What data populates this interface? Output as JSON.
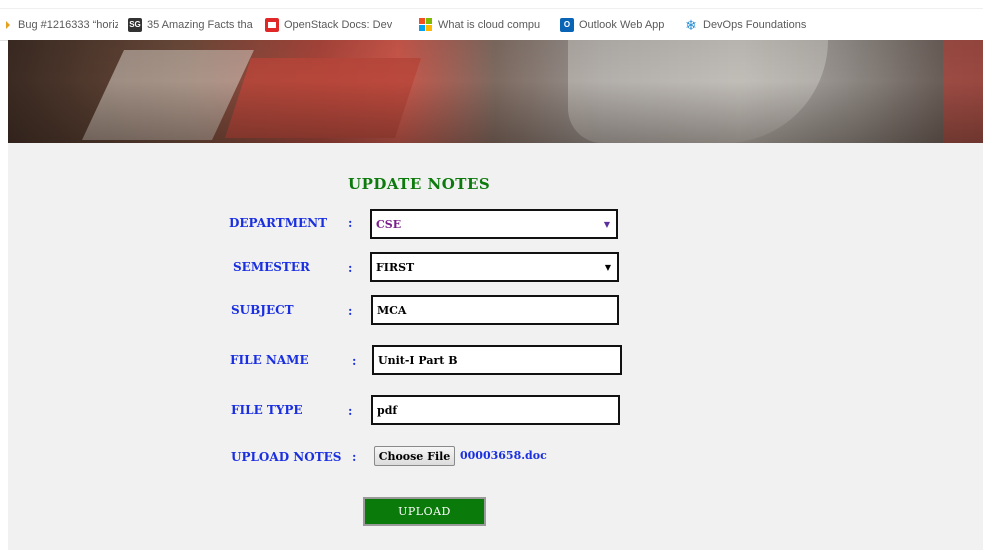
{
  "bookmarks": [
    {
      "label": "Bug #1216333 “horiz",
      "icon": "bug-page-icon"
    },
    {
      "label": "35 Amazing Facts tha",
      "icon": "sg-icon"
    },
    {
      "label": "OpenStack Docs: Dev",
      "icon": "openstack-icon"
    },
    {
      "label": "What is cloud compu",
      "icon": "microsoft-icon"
    },
    {
      "label": "Outlook Web App",
      "icon": "outlook-icon"
    },
    {
      "label": "DevOps Foundations",
      "icon": "snowflake-icon"
    }
  ],
  "form": {
    "title": "UPDATE NOTES",
    "department": {
      "label": "DEPARTMENT",
      "value": "CSE"
    },
    "semester": {
      "label": "SEMESTER",
      "value": "FIRST"
    },
    "subject": {
      "label": "SUBJECT",
      "value": "MCA"
    },
    "file_name": {
      "label": "FILE NAME",
      "value": "Unit-I Part B"
    },
    "file_type": {
      "label": "FILE TYPE",
      "value": "pdf"
    },
    "upload_notes": {
      "label": "UPLOAD NOTES",
      "button": "Choose File",
      "selected_file": "00003658.doc"
    },
    "colon": ":",
    "submit_label": "UPLOAD"
  },
  "colors": {
    "title": "#0c7a0c",
    "label": "#1a2fe0",
    "submit_bg": "#0a7a0a",
    "department_value": "#7a1e8a",
    "background": "#f1f1f1"
  }
}
